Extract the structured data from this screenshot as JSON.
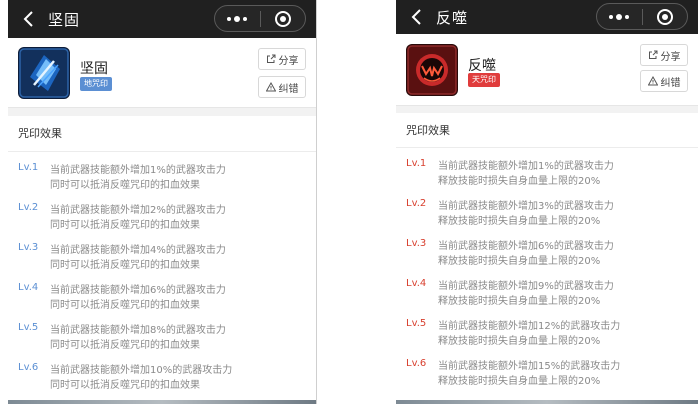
{
  "left": {
    "nav_title": "坚固",
    "rune_name": "坚固",
    "rune_tag": "地咒印",
    "share_label": "分享",
    "report_label": "纠错",
    "section_title": "咒印效果",
    "levels": [
      {
        "label": "Lv.1",
        "line1": "当前武器技能额外增加1%的武器攻击力",
        "line2": "同时可以抵消反噬咒印的扣血效果"
      },
      {
        "label": "Lv.2",
        "line1": "当前武器技能额外增加2%的武器攻击力",
        "line2": "同时可以抵消反噬咒印的扣血效果"
      },
      {
        "label": "Lv.3",
        "line1": "当前武器技能额外增加4%的武器攻击力",
        "line2": "同时可以抵消反噬咒印的扣血效果"
      },
      {
        "label": "Lv.4",
        "line1": "当前武器技能额外增加6%的武器攻击力",
        "line2": "同时可以抵消反噬咒印的扣血效果"
      },
      {
        "label": "Lv.5",
        "line1": "当前武器技能额外增加8%的武器攻击力",
        "line2": "同时可以抵消反噬咒印的扣血效果"
      },
      {
        "label": "Lv.6",
        "line1": "当前武器技能额外增加10%的武器攻击力",
        "line2": "同时可以抵消反噬咒印的扣血效果"
      }
    ],
    "accent": "#5b8fd3",
    "emblem_icon": "blue-rune-emblem-icon"
  },
  "right": {
    "nav_title": "反噬",
    "rune_name": "反噬",
    "rune_tag": "天咒印",
    "share_label": "分享",
    "report_label": "纠错",
    "section_title": "咒印效果",
    "levels": [
      {
        "label": "Lv.1",
        "line1": "当前武器技能额外增加1%的武器攻击力",
        "line2": "释放技能时损失自身血量上限的20%"
      },
      {
        "label": "Lv.2",
        "line1": "当前武器技能额外增加3%的武器攻击力",
        "line2": "释放技能时损失自身血量上限的20%"
      },
      {
        "label": "Lv.3",
        "line1": "当前武器技能额外增加6%的武器攻击力",
        "line2": "释放技能时损失自身血量上限的20%"
      },
      {
        "label": "Lv.4",
        "line1": "当前武器技能额外增加9%的武器攻击力",
        "line2": "释放技能时损失自身血量上限的20%"
      },
      {
        "label": "Lv.5",
        "line1": "当前武器技能额外增加12%的武器攻击力",
        "line2": "释放技能时损失自身血量上限的20%"
      },
      {
        "label": "Lv.6",
        "line1": "当前武器技能额外增加15%的武器攻击力",
        "line2": "释放技能时损失自身血量上限的20%"
      }
    ],
    "accent": "#d8402f",
    "emblem_icon": "red-rune-emblem-icon"
  }
}
